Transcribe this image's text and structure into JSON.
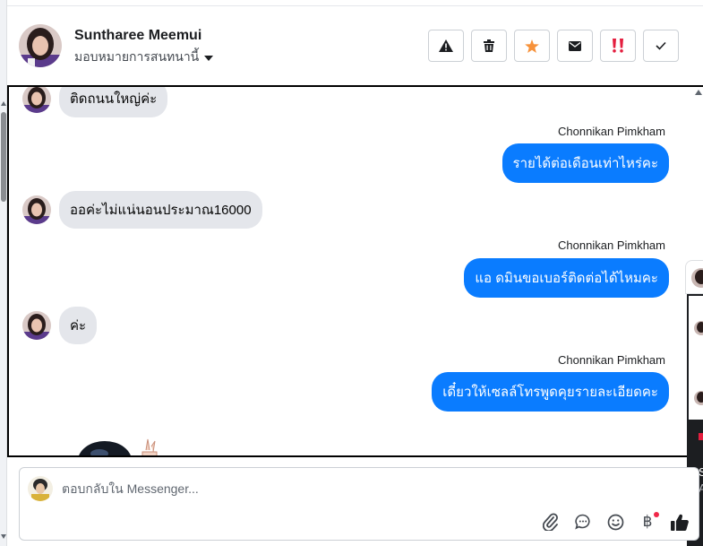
{
  "header": {
    "contact_name": "Suntharee Meemui",
    "assign_label": "มอบหมายการสนทนานี้",
    "actions": [
      {
        "name": "report-spam-button",
        "icon": "warning-icon"
      },
      {
        "name": "delete-button",
        "icon": "trash-icon"
      },
      {
        "name": "star-button",
        "icon": "star-icon"
      },
      {
        "name": "mark-unread-button",
        "icon": "envelope-icon"
      },
      {
        "name": "follow-up-button",
        "icon": "double-exclamation-icon"
      },
      {
        "name": "mark-done-button",
        "icon": "checkmark-icon"
      }
    ]
  },
  "conversation": {
    "messages": [
      {
        "direction": "in",
        "text": "ติดถนนใหญ่ค่ะ"
      },
      {
        "direction": "out",
        "sender": "Chonnikan Pimkham",
        "text": "รายได้ต่อเดือนเท่าไหร่คะ"
      },
      {
        "direction": "in",
        "text": "ออค่ะไม่แน่นอนประมาณ16000"
      },
      {
        "direction": "out",
        "sender": "Chonnikan Pimkham",
        "text": "แอ ดมินขอเบอร์ติดต่อได้ไหมคะ"
      },
      {
        "direction": "in",
        "text": "ค่ะ"
      },
      {
        "direction": "out",
        "sender": "Chonnikan Pimkham",
        "text": "เดี๋ยวให้เซลล์โทรพูดคุยรายละเอียดคะ"
      }
    ]
  },
  "side_panel": {
    "text_line_1": "S",
    "text_line_2": "A"
  },
  "reply": {
    "placeholder": "ตอบกลับใน Messenger...",
    "tools": [
      {
        "name": "attach-button",
        "icon": "paperclip-icon"
      },
      {
        "name": "saved-replies-button",
        "icon": "chat-bubble-icon"
      },
      {
        "name": "emoji-button",
        "icon": "smiley-icon"
      },
      {
        "name": "payment-button",
        "icon": "baht-icon",
        "glyph": "฿",
        "has_badge": true
      },
      {
        "name": "like-button",
        "icon": "thumbs-up-icon"
      }
    ]
  },
  "colors": {
    "outgoing_bubble": "#0a7cff",
    "incoming_bubble": "#e4e6eb",
    "star": "#f7923a",
    "follow_up": "#e41e3f"
  }
}
